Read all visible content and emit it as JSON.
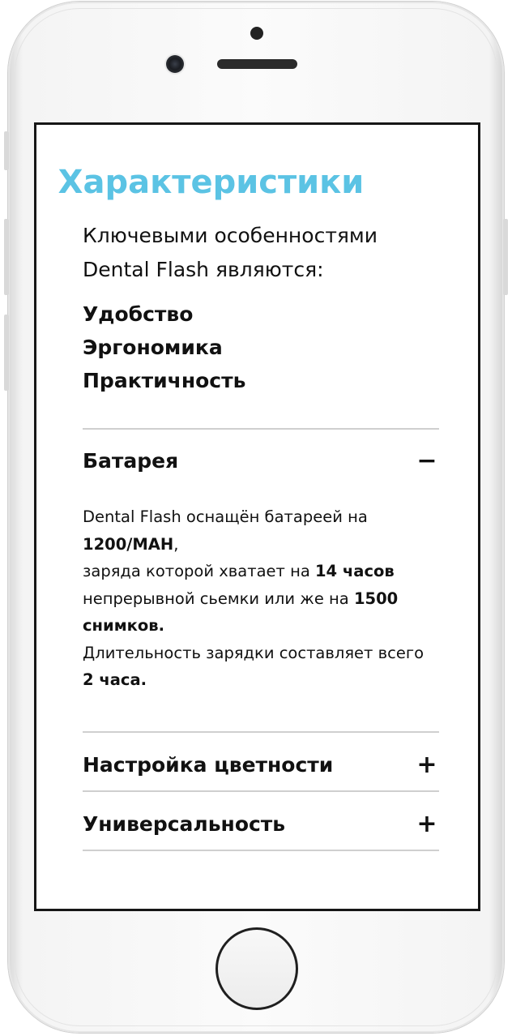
{
  "page": {
    "title": "Характеристики",
    "intro": "Ключевыми особенностями Dental Flash являются:",
    "features": [
      "Удобство",
      "Эргономика",
      "Практичность"
    ]
  },
  "accordion": [
    {
      "title": "Батарея",
      "toggle": "−",
      "expanded": true,
      "body": {
        "t1": "Dental Flash оснащён батареей на ",
        "b1": "1200/MAH",
        "t2": ",",
        "t3": "заряда которой хватает на ",
        "b2": "14 часов",
        "t4": "непрерывной сьемки или же на ",
        "b3": "1500 снимков.",
        "t5": "Длительность зарядки составляет всего ",
        "b4": "2 часа."
      }
    },
    {
      "title": "Настройка цветности",
      "toggle": "+",
      "expanded": false
    },
    {
      "title": "Универсальность",
      "toggle": "+",
      "expanded": false
    }
  ],
  "colors": {
    "accent": "#5bc3e4",
    "text": "#111111",
    "divider": "#cfcfcf"
  }
}
